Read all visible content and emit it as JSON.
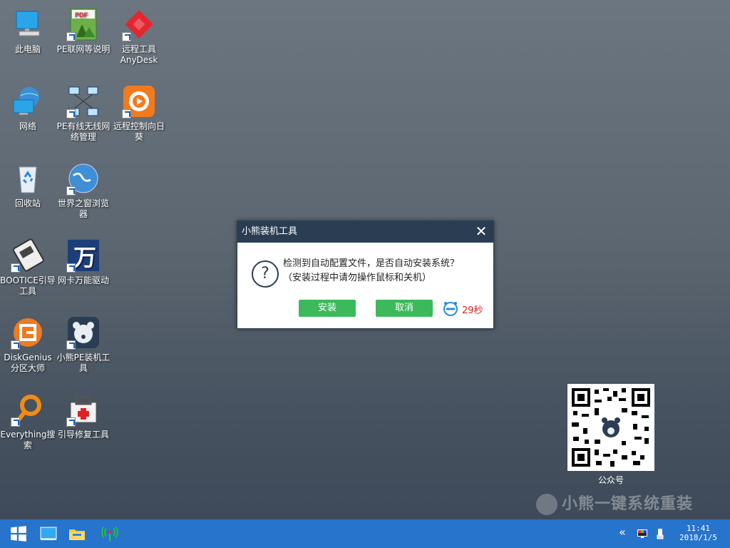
{
  "desktop_icons": [
    {
      "label": "此电脑",
      "name": "this-pc-icon"
    },
    {
      "label": "PE联网等说明",
      "name": "pe-network-doc-icon"
    },
    {
      "label": "远程工具AnyDesk",
      "name": "anydesk-icon"
    },
    {
      "label": "网络",
      "name": "network-icon"
    },
    {
      "label": "PE有线无线网络管理",
      "name": "network-manager-icon"
    },
    {
      "label": "远程控制向日葵",
      "name": "sunflower-remote-icon"
    },
    {
      "label": "回收站",
      "name": "recycle-bin-icon"
    },
    {
      "label": "世界之窗浏览器",
      "name": "browser-icon"
    },
    {
      "label": "BOOTICE引导工具",
      "name": "bootice-icon"
    },
    {
      "label": "网卡万能驱动",
      "name": "nic-driver-icon"
    },
    {
      "label": "DiskGenius分区大师",
      "name": "diskgenius-icon"
    },
    {
      "label": "小熊PE装机工具",
      "name": "bear-pe-installer-icon"
    },
    {
      "label": "Everything搜索",
      "name": "everything-search-icon"
    },
    {
      "label": "引导修复工具",
      "name": "boot-repair-icon"
    }
  ],
  "dialog": {
    "title": "小熊装机工具",
    "message_line1": "检测到自动配置文件，是否自动安装系统？",
    "message_line2": "（安装过程中请勿操作鼠标和关机）",
    "install_label": "安装",
    "cancel_label": "取消",
    "countdown": "29秒",
    "close_glyph": "✕",
    "question_glyph": "?"
  },
  "qr_label": "公众号",
  "watermark": "小熊一键系统重装",
  "taskbar": {
    "time": "11:41",
    "date": "2018/1/5",
    "expand_glyph": "«"
  },
  "colors": {
    "taskbar": "#2674cc",
    "dialog_header": "#2b3d52",
    "button_green": "#3cb95a",
    "countdown_red": "#e02020"
  }
}
